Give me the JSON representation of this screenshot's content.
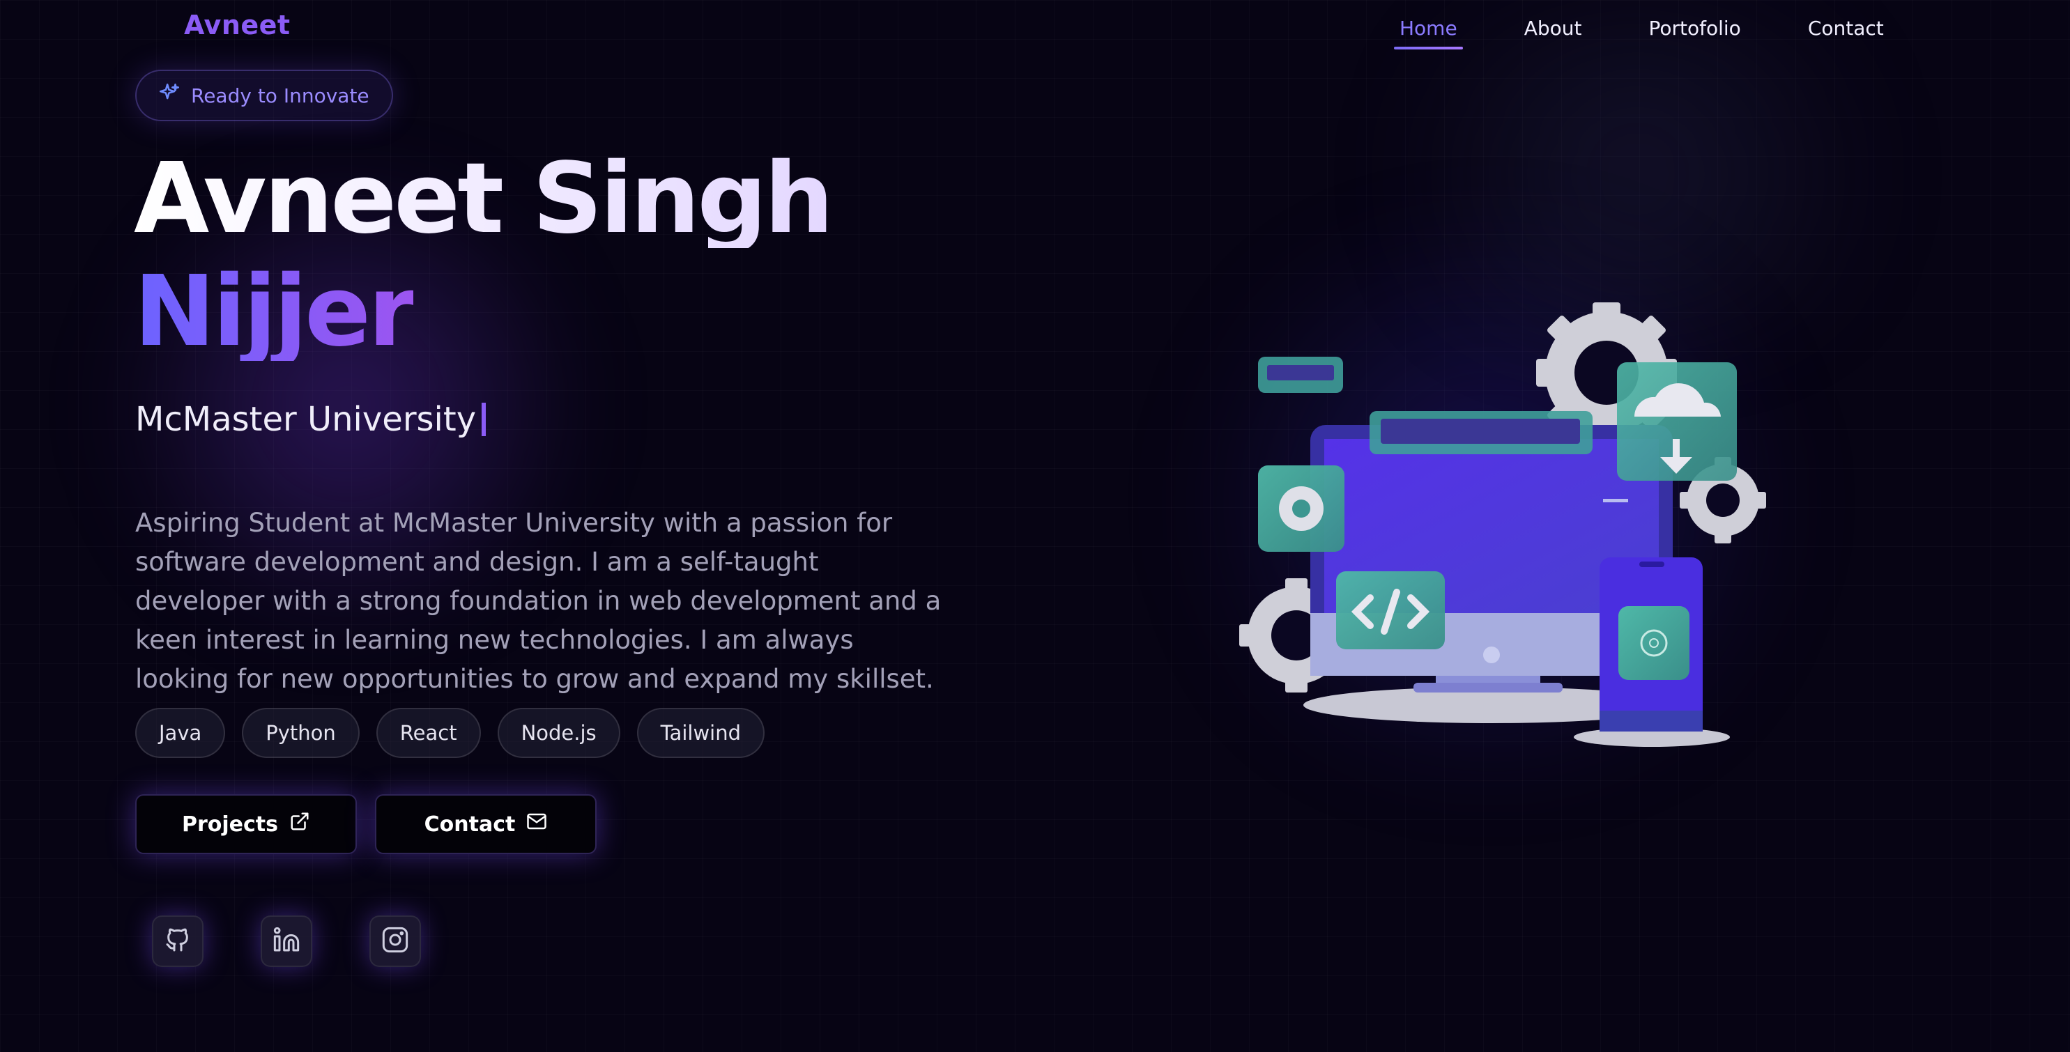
{
  "brand": {
    "logo": "Avneet"
  },
  "nav": {
    "items": [
      {
        "label": "Home",
        "active": true
      },
      {
        "label": "About"
      },
      {
        "label": "Portofolio"
      },
      {
        "label": "Contact"
      }
    ]
  },
  "hero": {
    "badge": "Ready to Innovate",
    "name_line1": "Avneet Singh",
    "name_line2": "Nijjer",
    "subtitle": "McMaster University",
    "description": "Aspiring Student at McMaster University with a passion for software development and design. I am a self-taught developer with a strong foundation in web development and a keen interest in learning new technologies. I am always looking for new opportunities to grow and expand my skillset.",
    "tags": [
      "Java",
      "Python",
      "React",
      "Node.js",
      "Tailwind"
    ],
    "buttons": {
      "projects": "Projects",
      "contact": "Contact"
    }
  },
  "social": {
    "icons": [
      "github-icon",
      "linkedin-icon",
      "instagram-icon"
    ]
  },
  "colors": {
    "accent": "#8b5cf6",
    "background": "#070414",
    "teal": "#3fa89a"
  }
}
